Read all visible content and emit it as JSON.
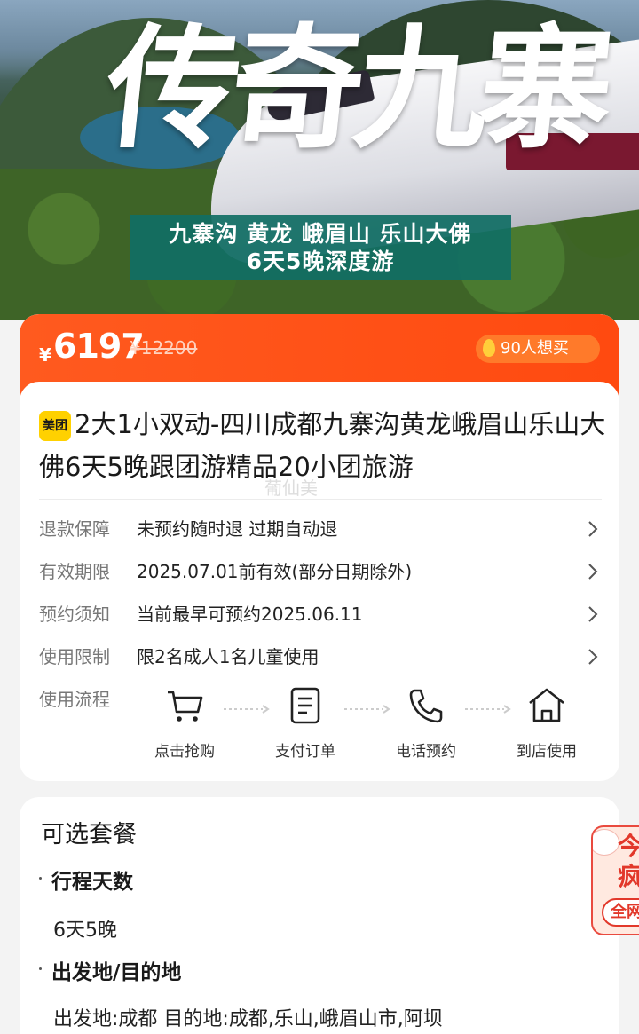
{
  "hero": {
    "calligraphy": "传奇九寨",
    "banner_line1": "九寨沟 黄龙 峨眉山 乐山大佛",
    "banner_line2": "6天5晚深度游"
  },
  "price": {
    "currency": "¥",
    "current": "6197",
    "original": "¥12200",
    "want_count": "90人想买",
    "accent_color": "#ff4a10"
  },
  "product": {
    "badge": "美团",
    "title": "2大1小双动-四川成都九寨沟黄龙峨眉山乐山大佛6天5晚跟团游精品20小团旅游",
    "watermark": "葡仙美"
  },
  "info_rows": [
    {
      "label": "退款保障",
      "value": "未预约随时退 过期自动退"
    },
    {
      "label": "有效期限",
      "value": "2025.07.01前有效(部分日期除外)"
    },
    {
      "label": "预约须知",
      "value": "当前最早可预约2025.06.11"
    },
    {
      "label": "使用限制",
      "value": "限2名成人1名儿童使用"
    }
  ],
  "flow": {
    "label": "使用流程",
    "steps": [
      {
        "label": "点击抢购",
        "icon": "cart-icon"
      },
      {
        "label": "支付订单",
        "icon": "document-icon"
      },
      {
        "label": "电话预约",
        "icon": "phone-icon"
      },
      {
        "label": "到店使用",
        "icon": "home-icon"
      }
    ]
  },
  "packages": {
    "title": "可选套餐",
    "sections": [
      {
        "heading": "行程天数",
        "value": "6天5晚"
      },
      {
        "heading": "出发地/目的地",
        "value": "出发地:成都 目的地:成都,乐山,峨眉山市,阿坝"
      }
    ]
  },
  "promo": {
    "line1": "今",
    "line2": "疯",
    "tag": "全网"
  }
}
